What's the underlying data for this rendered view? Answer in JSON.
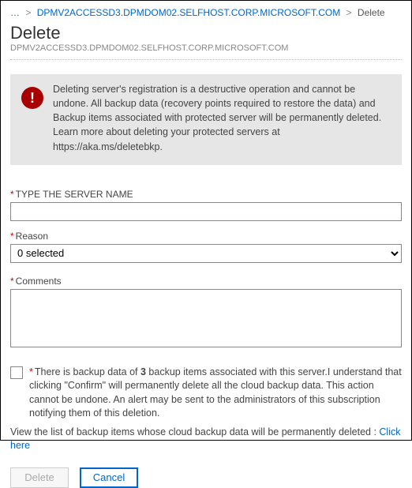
{
  "breadcrumb": {
    "ellipsis": "…",
    "parent": "DPMV2ACCESSD3.DPMDOM02.SELFHOST.CORP.MICROSOFT.COM",
    "current": "Delete"
  },
  "header": {
    "title": "Delete",
    "subtitle": "DPMV2ACCESSD3.DPMDOM02.SELFHOST.CORP.MICROSOFT.COM"
  },
  "warning": {
    "icon_glyph": "!",
    "text": "Deleting server's registration is a destructive operation and cannot be undone. All backup data (recovery points required to restore the data) and Backup items associated with protected server will be permanently deleted. Learn more about deleting your protected servers at https://aka.ms/deletebkp."
  },
  "fields": {
    "server_name": {
      "label": "TYPE THE SERVER NAME",
      "value": ""
    },
    "reason": {
      "label": "Reason",
      "selected": "0 selected"
    },
    "comments": {
      "label": "Comments",
      "value": ""
    }
  },
  "ack": {
    "prefix": "There is backup data of ",
    "count": "3",
    "suffix": " backup items associated with this server.I understand that clicking \"Confirm\" will permanently delete all the cloud backup data. This action cannot be undone. An alert may be sent to the administrators of this subscription notifying them of this deletion."
  },
  "list_note": {
    "text": "View the list of backup items whose cloud backup data will be permanently deleted : ",
    "link": "Click here"
  },
  "buttons": {
    "delete": "Delete",
    "cancel": "Cancel"
  }
}
